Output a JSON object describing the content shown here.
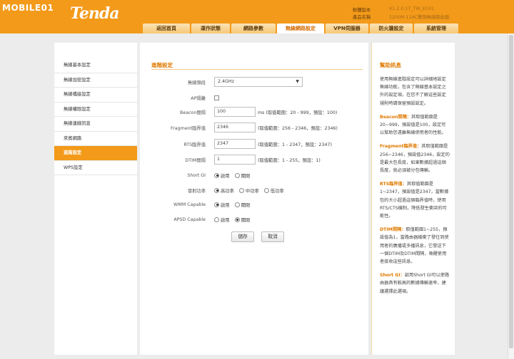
{
  "watermark": "MOBILE01",
  "brand": "Tenda",
  "device_info": {
    "fw_label": "軟體版本",
    "fw_value": "V1.2.0.17_TW_EC01",
    "model_label": "產品名稱",
    "model_value": "1200M 11AC雙頻無線路由器"
  },
  "nav": {
    "tabs": [
      "返回首頁",
      "運作狀態",
      "網路參數",
      "無線網路設定",
      "VPN伺服器",
      "防火牆設定",
      "系統管理"
    ],
    "active_index": 3
  },
  "sidebar": {
    "items": [
      "無線基本設定",
      "無線加密設定",
      "無線橋接設定",
      "無線權限設定",
      "無線連線訊息",
      "來賓網路",
      "進階設定",
      "WPS設定"
    ],
    "active_index": 6
  },
  "main": {
    "title": "進階設定",
    "fields": {
      "band": {
        "label": "無線頻段",
        "value": "2.4GHz"
      },
      "ap_isolation": {
        "label": "AP隔離"
      },
      "beacon": {
        "label": "Beacon間隔",
        "value": "100",
        "hint": "ms (取值範圍：20 - 999，預設：100)"
      },
      "fragment": {
        "label": "Fragment臨界值",
        "value": "2346",
        "hint": "(取值範圍：256 - 2346，預設：2346)"
      },
      "rts": {
        "label": "RTS臨界值",
        "value": "2347",
        "hint": "(取值範圍：1 - 2347，預設：2347)"
      },
      "dtim": {
        "label": "DTIM間隔",
        "value": "1",
        "hint": "(取值範圍：1 - 255，預設：1)"
      },
      "short_gi": {
        "label": "Short GI",
        "opt_on": "啟用",
        "opt_off": "關閉"
      },
      "tx_power": {
        "label": "發射功率",
        "opt_high": "高功率",
        "opt_mid": "中功率",
        "opt_low": "低功率"
      },
      "wmm": {
        "label": "WMM Capable",
        "opt_on": "啟用",
        "opt_off": "關閉"
      },
      "apsd": {
        "label": "APSD Capable",
        "opt_on": "啟用",
        "opt_off": "關閉"
      }
    },
    "save_label": "儲存",
    "cancel_label": "取消"
  },
  "help": {
    "title": "幫助訊息",
    "intro": "使用無線進階設定可以詳細地設定無線功能，包含了無線基本設定之外的設定項，在您不了解這些設定規則時請保留預設設定。",
    "items": [
      {
        "key": "Beacon間隔：",
        "text": "其取值範圍是20~999，預設值是100，設定可以幫助您遠離無線使用者的性能。"
      },
      {
        "key": "Fragment臨界值：",
        "text": "其取值範圍是256~2346，預設值2346，設定的是最大包長度，如果數據超過這個長度，就必須被分包傳輸。"
      },
      {
        "key": "RTS臨界值：",
        "text": "其取值範圍是1~2347，預設值是2347，當數據包的大小超過這個臨界值時，使用RTS/CTS機制，降低發生衝突的可能性。"
      },
      {
        "key": "DTIM間隔：",
        "text": "取值範圍1~255，預設值為1，當路由器緩衝了發往到使用者的廣播或多播訊息，它發送下一個DTIM及DTIM間隔，喚醒使用者接收這些訊息。"
      },
      {
        "key": "Short GI：",
        "text": "啟用Short GI可以使路由器具有較高的數據傳輸速率，建議選擇此選項。"
      }
    ]
  },
  "colors": {
    "accent": "#f39a1a",
    "accent_text": "#e07a00"
  }
}
